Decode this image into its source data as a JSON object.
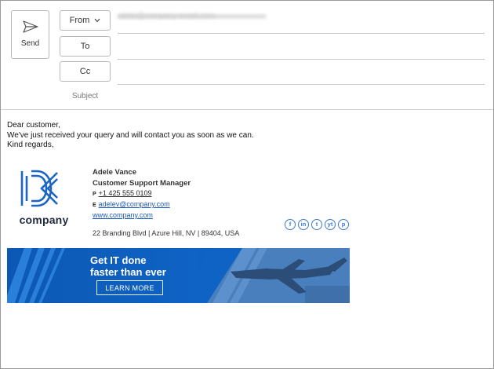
{
  "header": {
    "send_label": "Send",
    "from_label": "From",
    "to_label": "To",
    "cc_label": "Cc",
    "subject_label": "Subject",
    "from_value": "adele@company-email.com",
    "to_value": "",
    "cc_value": "",
    "subject_value": ""
  },
  "message": {
    "lines": [
      "Dear customer,",
      "We've just received your query and will contact you as soon as we can.",
      "Kind regards,"
    ]
  },
  "signature": {
    "logo_text": "company",
    "name": "Adele Vance",
    "title": "Customer Support Manager",
    "phone_prefix": "P",
    "phone": "+1 425 555 0109",
    "email_prefix": "E",
    "email": "adelev@company.com",
    "website": "www.company.com",
    "address": "22 Branding Blvd | Azure Hill, NV | 89404, USA",
    "socials": [
      {
        "icon": "facebook-icon",
        "glyph": "f"
      },
      {
        "icon": "linkedin-icon",
        "glyph": "in"
      },
      {
        "icon": "twitter-icon",
        "glyph": "t"
      },
      {
        "icon": "youtube-icon",
        "glyph": "yt"
      },
      {
        "icon": "pinterest-icon",
        "glyph": "p"
      }
    ]
  },
  "banner": {
    "headline_line1": "Get IT done",
    "headline_line2": "faster than ever",
    "cta": "LEARN MORE"
  },
  "colors": {
    "accent": "#1e5bbd",
    "banner_blue": "#0f63c4",
    "logo_blue": "#1a66c2"
  }
}
